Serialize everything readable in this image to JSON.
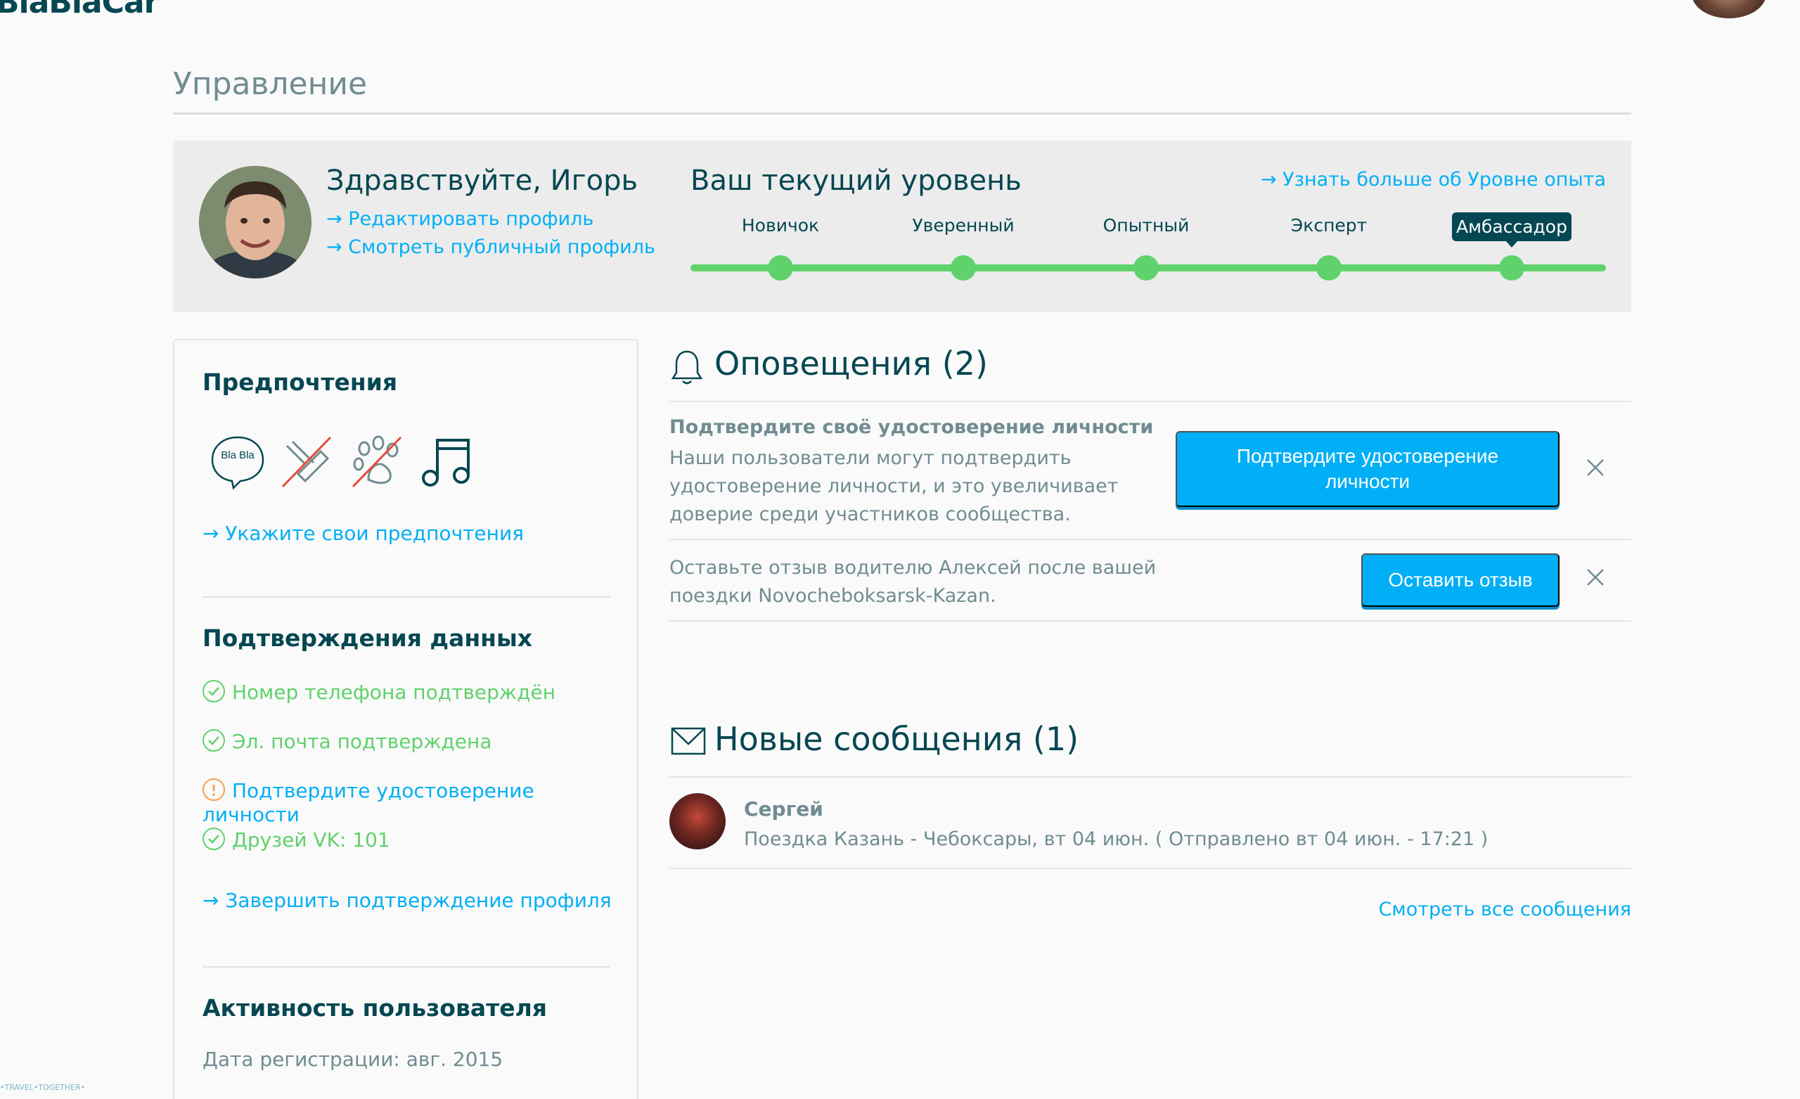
{
  "brand": {
    "logo_text": "BlaBlaCar"
  },
  "page": {
    "title": "Управление"
  },
  "profile": {
    "greeting": "Здравствуйте, Игорь",
    "edit_link": "→ Редактировать профиль",
    "public_link": "→ Смотреть публичный профиль"
  },
  "level": {
    "title": "Ваш текущий уровень",
    "more_link": "→ Узнать больше об Уровне опыта",
    "levels": [
      "Новичок",
      "Уверенный",
      "Опытный",
      "Эксперт",
      "Амбассадор"
    ],
    "current": "Амбассадор",
    "track_color": "#5fd26b"
  },
  "sidebar": {
    "preferences_title": "Предпочтения",
    "preference_icons": [
      "chat-blabla-icon",
      "no-smoking-icon",
      "no-pets-icon",
      "music-icon"
    ],
    "chat_icon_text": "Bla Bla",
    "preferences_link": "→ Укажите свои предпочтения",
    "verifications_title": "Подтверждения данных",
    "verifications": [
      {
        "label": "Номер телефона подтверждён",
        "status": "ok"
      },
      {
        "label": "Эл. почта подтверждена",
        "status": "ok"
      },
      {
        "label": "Подтвердите удостоверение личности",
        "status": "warning"
      },
      {
        "label": "Друзей VK: 101",
        "status": "ok"
      }
    ],
    "verification_link": "→ Завершить подтверждение профиля",
    "activity_title": "Активность пользователя",
    "registration_date": "Дата регистрации: авг. 2015"
  },
  "notifications": {
    "title": "Оповещения (2)",
    "items": [
      {
        "title": "Подтвердите своё удостоверение личности",
        "body": "Наши пользователи могут подтвердить удостоверение личности, и это увеличивает доверие среди участников сообщества.",
        "button": "Подтвердите удостоверение личности"
      },
      {
        "body": "Оставьте отзыв водителю Алексей после вашей поездки Novocheboksarsk-Kazan.",
        "button": "Оставить отзыв"
      }
    ]
  },
  "messages": {
    "title": "Новые сообщения (1)",
    "items": [
      {
        "sender": "Сергей",
        "text": "Поездка Казань - Чебоксары, вт 04 июн. ( Отправлено вт 04 июн. - 17:21 )"
      }
    ],
    "view_all": "Смотреть все сообщения"
  },
  "footer": {
    "watermark": "•TRAVEL•TOGETHER•"
  },
  "colors": {
    "accent": "#00aff5",
    "primary_text": "#054752",
    "secondary_text": "#708c91",
    "success": "#5fd26b",
    "warning": "#f5a04a"
  }
}
